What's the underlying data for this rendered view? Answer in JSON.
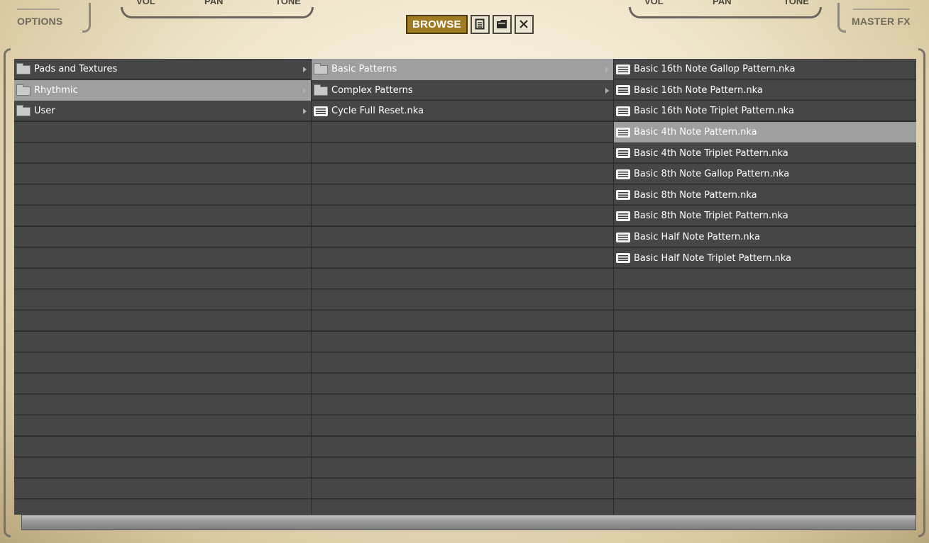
{
  "header": {
    "options_label": "OPTIONS",
    "master_fx_label": "MASTER FX",
    "left_knobs": {
      "vol": "VOL",
      "pan": "PAN",
      "tone": "TONE"
    },
    "right_knobs": {
      "vol": "VOL",
      "pan": "PAN",
      "tone": "TONE"
    },
    "toolbar": {
      "browse_label": "BROWSE",
      "icons": [
        "document-icon",
        "folder-icon",
        "close-icon"
      ]
    }
  },
  "colors": {
    "accent": "#a07b22",
    "panel_bg": "#464646",
    "selected_row": "#9f9f9f",
    "text": "#ffffff"
  },
  "browser": {
    "column1": [
      {
        "label": "Pads and Textures",
        "type": "folder",
        "has_children": true,
        "selected": false
      },
      {
        "label": "Rhythmic",
        "type": "folder",
        "has_children": true,
        "selected": true
      },
      {
        "label": "User",
        "type": "folder",
        "has_children": true,
        "selected": false
      }
    ],
    "column2": [
      {
        "label": "Basic Patterns",
        "type": "folder",
        "has_children": true,
        "selected": true
      },
      {
        "label": "Complex Patterns",
        "type": "folder",
        "has_children": true,
        "selected": false
      },
      {
        "label": "Cycle Full Reset.nka",
        "type": "file",
        "has_children": false,
        "selected": false
      }
    ],
    "column3": [
      {
        "label": "Basic 16th Note Gallop Pattern.nka",
        "type": "file",
        "selected": false
      },
      {
        "label": "Basic 16th Note Pattern.nka",
        "type": "file",
        "selected": false
      },
      {
        "label": "Basic 16th Note Triplet Pattern.nka",
        "type": "file",
        "selected": false
      },
      {
        "label": "Basic 4th Note Pattern.nka",
        "type": "file",
        "selected": true
      },
      {
        "label": "Basic 4th Note Triplet Pattern.nka",
        "type": "file",
        "selected": false
      },
      {
        "label": "Basic 8th Note Gallop Pattern.nka",
        "type": "file",
        "selected": false
      },
      {
        "label": "Basic 8th Note Pattern.nka",
        "type": "file",
        "selected": false
      },
      {
        "label": "Basic 8th Note Triplet Pattern.nka",
        "type": "file",
        "selected": false
      },
      {
        "label": "Basic Half Note Pattern.nka",
        "type": "file",
        "selected": false
      },
      {
        "label": "Basic Half Note Triplet Pattern.nka",
        "type": "file",
        "selected": false
      }
    ]
  }
}
